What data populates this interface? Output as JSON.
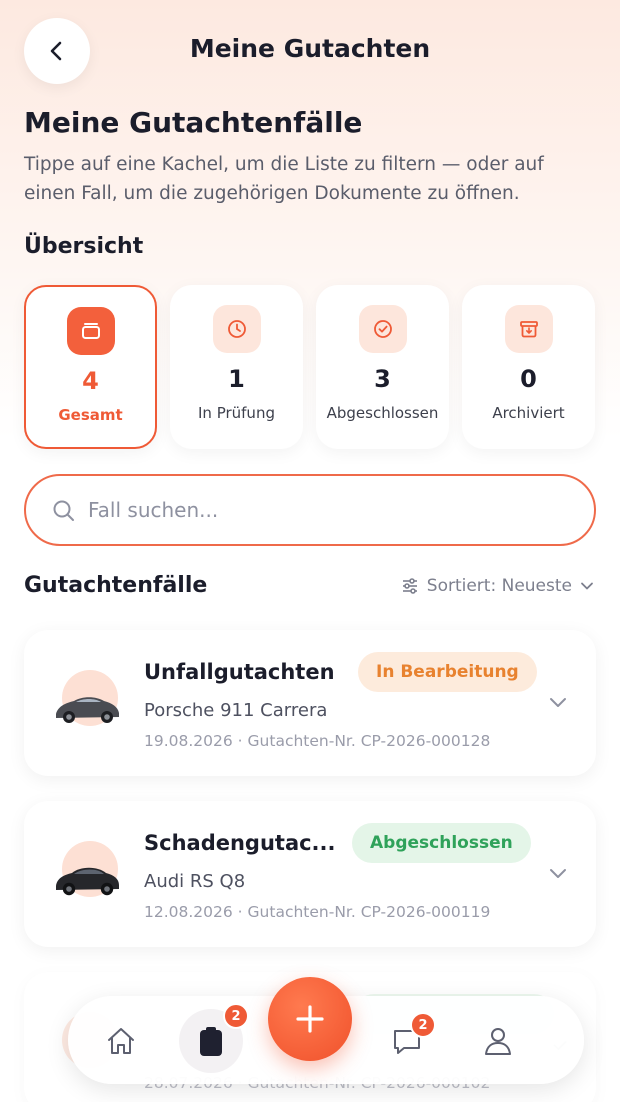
{
  "header": {
    "title": "Meine Gutachten",
    "back_icon": "chevron-left-icon"
  },
  "page": {
    "title": "Meine Gutachtenfälle",
    "description": "Tippe auf eine Kachel, um die Liste zu filtern — oder auf einen Fall, um die zugehörigen Dokumente zu öffnen."
  },
  "overview": {
    "label": "Übersicht",
    "tiles": [
      {
        "count": "4",
        "label": "Gesamt",
        "icon": "stack-icon",
        "active": true
      },
      {
        "count": "1",
        "label": "In Prüfung",
        "icon": "clock-icon",
        "active": false
      },
      {
        "count": "3",
        "label": "Abgeschlossen",
        "icon": "check-circle-icon",
        "active": false
      },
      {
        "count": "0",
        "label": "Archiviert",
        "icon": "archive-icon",
        "active": false
      }
    ]
  },
  "search": {
    "placeholder": "Fall suchen..."
  },
  "list": {
    "title": "Gutachtenfälle",
    "sort_label": "Sortiert: Neueste"
  },
  "cases": [
    {
      "title": "Unfallgutachten",
      "badge": "In Bearbeitung",
      "badge_color": "#e8822f",
      "vehicle": "Porsche 911 Carrera",
      "meta": "19.08.2026 · Gutachten-Nr. CP-2026-000128"
    },
    {
      "title": "Schadengutac...",
      "badge": "Abgeschlossen",
      "badge_color": "#2fa25a",
      "vehicle": "Audi RS Q8",
      "meta": "12.08.2026 · Gutachten-Nr. CP-2026-000119"
    },
    {
      "title": "",
      "badge": "",
      "vehicle": "",
      "meta": "28.07.2026 · Gutachten-Nr. CP-2026-000102"
    }
  ],
  "nav": {
    "items": [
      {
        "icon": "home-icon"
      },
      {
        "icon": "clipboard-icon",
        "badge": "2"
      },
      {
        "icon": "plus-icon"
      },
      {
        "icon": "chat-icon",
        "badge": "2"
      },
      {
        "icon": "user-icon"
      }
    ]
  },
  "colors": {
    "accent": "#ef5a36",
    "text": "#1b1d2b",
    "muted": "#9a9caa"
  }
}
